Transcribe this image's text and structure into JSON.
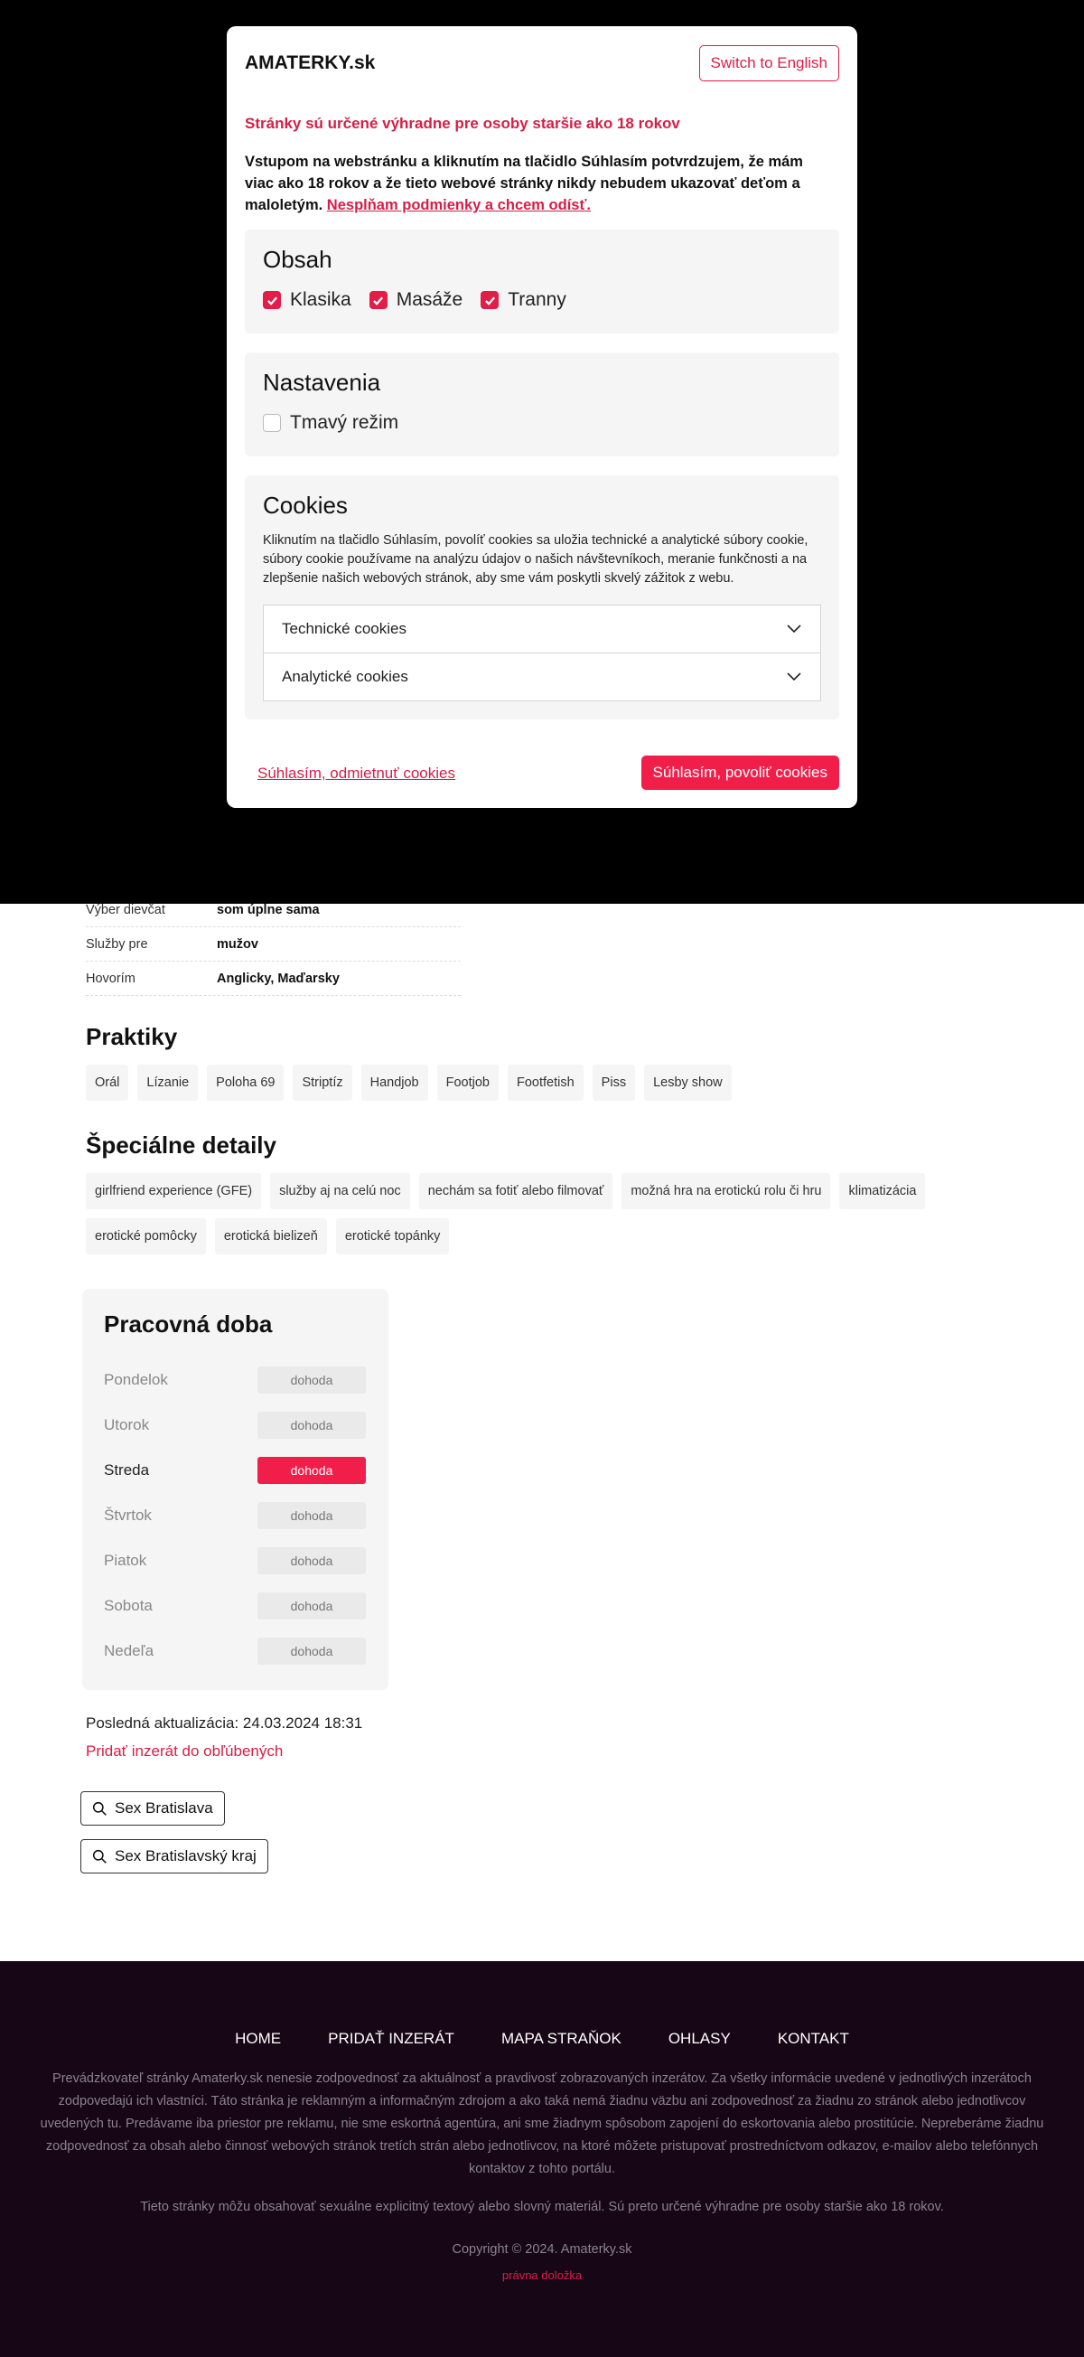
{
  "modal": {
    "brand": "AMATERKY.sk",
    "switch_lang": "Switch to English",
    "warning_title": "Stránky sú určené výhradne pre osoby staršie ako 18 rokov",
    "warning_text": "Vstupom na webstránku a kliknutím na tlačidlo Súhlasím potvrdzujem, že mám viac ako 18 rokov a že tieto webové stránky nikdy nebudem ukazovať deťom a maloletým. ",
    "leave_link": "Nesplňam podmienky a chcem odísť.",
    "content": {
      "title": "Obsah",
      "options": [
        {
          "label": "Klasika",
          "checked": true
        },
        {
          "label": "Masáže",
          "checked": true
        },
        {
          "label": "Tranny",
          "checked": true
        }
      ]
    },
    "settings": {
      "title": "Nastavenia",
      "dark_mode": {
        "label": "Tmavý režim",
        "checked": false
      }
    },
    "cookies": {
      "title": "Cookies",
      "text": "Kliknutím na tlačidlo Súhlasím, povolíť cookies sa uložia technické a analytické súbory cookie, súbory cookie používame na analýzu údajov o našich návštevníkoch, meranie funkčnosti a na zlepšenie našich webových stránok, aby sme vám poskytli skvelý zážitok z webu.",
      "technical": "Technické cookies",
      "analytics": "Analytické cookies"
    },
    "decline": "Súhlasím, odmietnuť cookies",
    "accept": "Súhlasím, povoliť cookies"
  },
  "info": [
    {
      "key": "Výber dievčat",
      "value": "som úplne sama"
    },
    {
      "key": "Služby pre",
      "value": "mužov"
    },
    {
      "key": "Hovorím",
      "value": "Anglicky, Maďarsky"
    }
  ],
  "practices": {
    "title": "Praktiky",
    "items": [
      "Orál",
      "Lízanie",
      "Poloha 69",
      "Striptíz",
      "Handjob",
      "Footjob",
      "Footfetish",
      "Piss",
      "Lesby show"
    ]
  },
  "special": {
    "title": "Špeciálne detaily",
    "items": [
      "girlfriend experience (GFE)",
      "služby aj na celú noc",
      "nechám sa fotiť alebo filmovať",
      "možná hra na erotickú rolu či hru",
      "klimatizácia",
      "erotické pomôcky",
      "erotická bielizeň",
      "erotické topánky"
    ]
  },
  "hours": {
    "title": "Pracovná doba",
    "days": [
      {
        "day": "Pondelok",
        "value": "dohoda"
      },
      {
        "day": "Utorok",
        "value": "dohoda"
      },
      {
        "day": "Streda",
        "value": "dohoda",
        "today": true
      },
      {
        "day": "Štvrtok",
        "value": "dohoda"
      },
      {
        "day": "Piatok",
        "value": "dohoda"
      },
      {
        "day": "Sobota",
        "value": "dohoda"
      },
      {
        "day": "Nedeľa",
        "value": "dohoda"
      }
    ]
  },
  "updated": {
    "label": "Posledná aktualizácia:",
    "value": "24.03.2024 18:31"
  },
  "favorite": "Pridať inzerát do obľúbených",
  "search_buttons": [
    "Sex Bratislava",
    "Sex Bratislavský kraj"
  ],
  "footer": {
    "nav": [
      "HOME",
      "PRIDAŤ INZERÁT",
      "MAPA STRAŇOK",
      "OHLASY",
      "KONTAKT"
    ],
    "disclaimer": "Prevádzkovateľ stránky Amaterky.sk nenesie zodpovednosť za aktuálnosť a pravdivosť zobrazovaných inzerátov. Za všetky informácie uvedené v jednotlivých inzerátoch zodpovedajú ich vlastníci.  Táto stránka je reklamným a informačným zdrojom a ako taká nemá žiadnu väzbu ani zodpovednosť za žiadnu zo stránok alebo jednotlivcov uvedených tu. Predávame iba priestor pre reklamu, nie sme eskortná agentúra, ani sme žiadnym spôsobom zapojení do eskortovania alebo prostitúcie. Nepreberáme žiadnu zodpovednosť za obsah alebo činnosť webových stránok tretích strán alebo jednotlivcov, na ktoré môžete pristupovať prostredníctvom odkazov, e-mailov alebo telefónnych kontaktov z tohto portálu.",
    "notice": "Tieto stránky môžu obsahovať sexuálne explicitný textový alebo slovný materiál. Sú preto určené výhradne pre osoby staršie ako 18 rokov.",
    "copyright": "Copyright © 2024. Amaterky.sk",
    "legal": "právna doložka"
  }
}
